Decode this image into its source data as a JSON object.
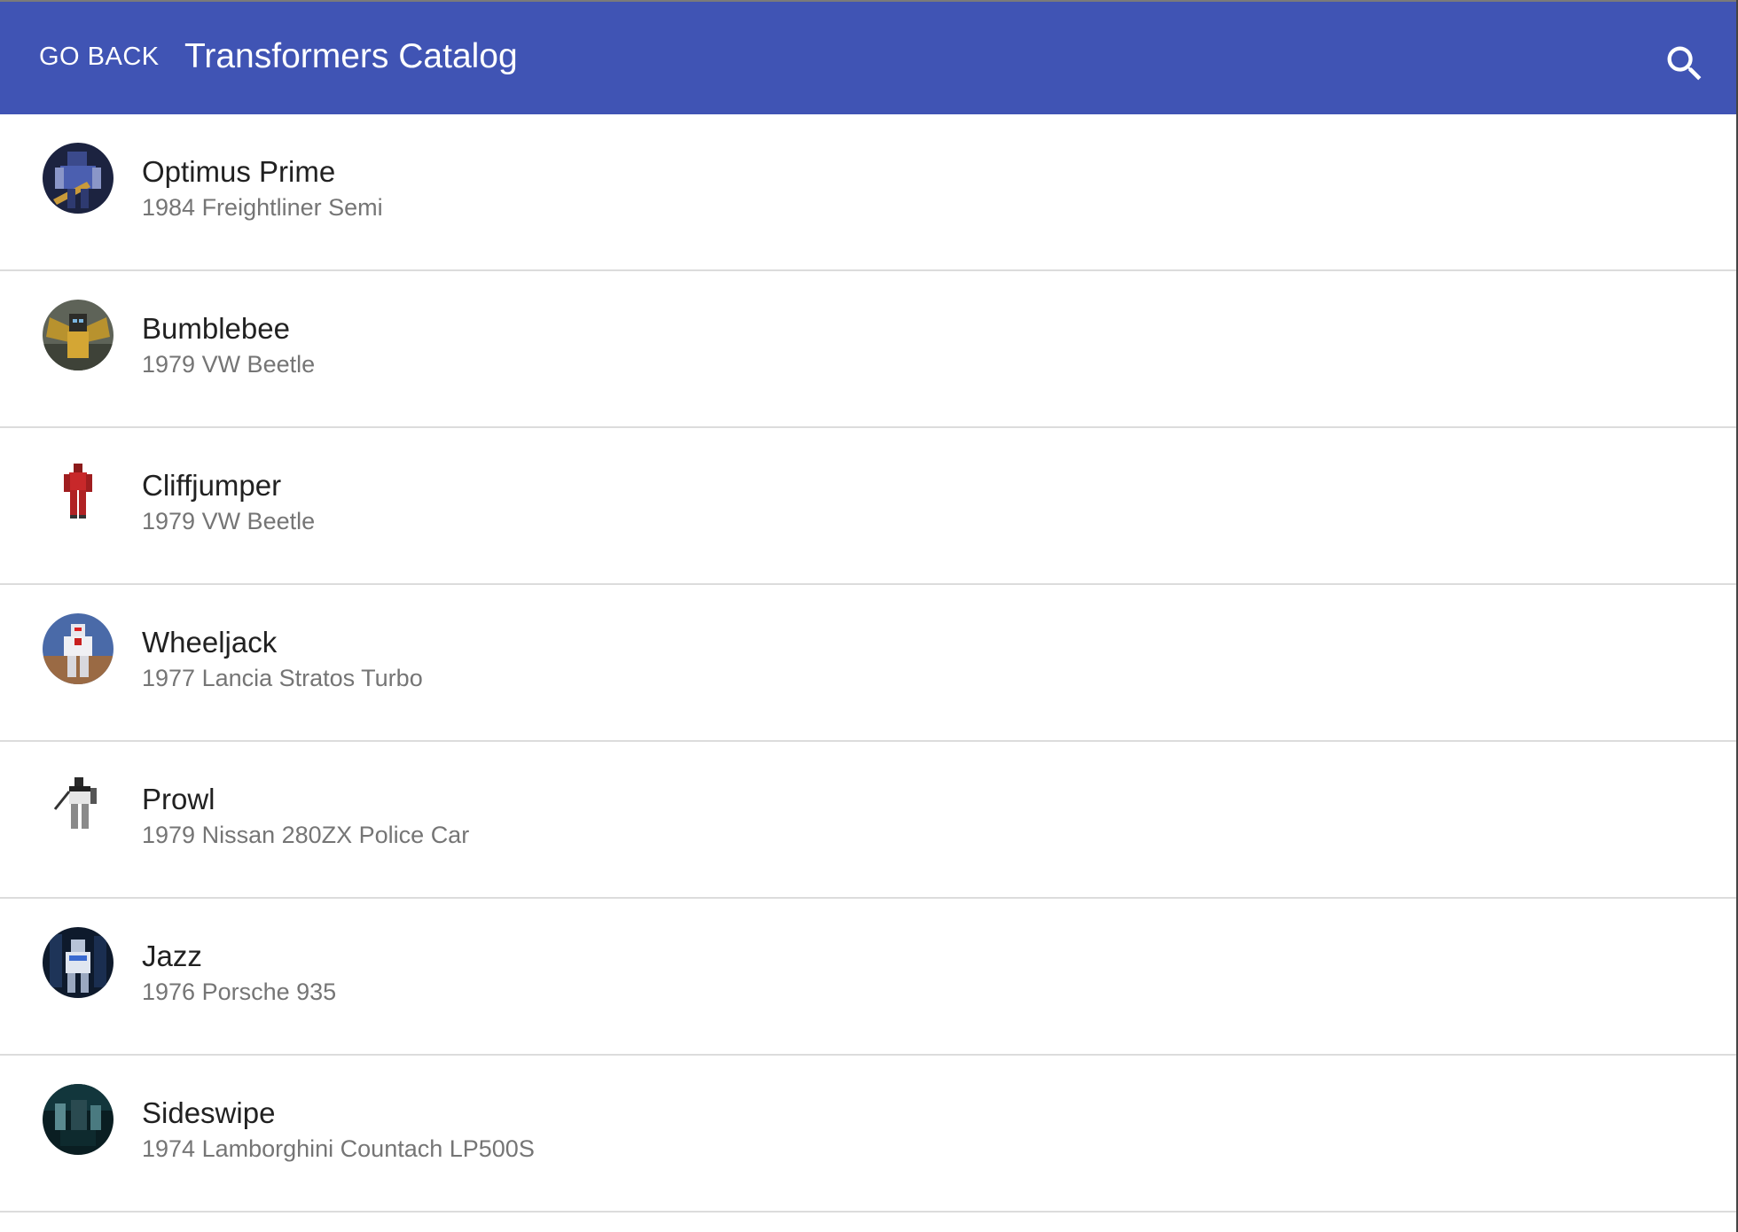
{
  "appbar": {
    "back_label": "GO BACK",
    "title": "Transformers Catalog",
    "search_icon": "search-icon",
    "color": "#4054b4"
  },
  "items": [
    {
      "name": "Optimus Prime",
      "vehicle": "1984 Freightliner Semi",
      "avatar": "optimus-prime-avatar"
    },
    {
      "name": "Bumblebee",
      "vehicle": "1979 VW Beetle",
      "avatar": "bumblebee-avatar"
    },
    {
      "name": "Cliffjumper",
      "vehicle": "1979 VW Beetle",
      "avatar": "cliffjumper-avatar"
    },
    {
      "name": "Wheeljack",
      "vehicle": "1977 Lancia Stratos Turbo",
      "avatar": "wheeljack-avatar"
    },
    {
      "name": "Prowl",
      "vehicle": "1979 Nissan 280ZX Police Car",
      "avatar": "prowl-avatar"
    },
    {
      "name": "Jazz",
      "vehicle": "1976 Porsche 935",
      "avatar": "jazz-avatar"
    },
    {
      "name": "Sideswipe",
      "vehicle": "1974 Lamborghini Countach LP500S",
      "avatar": "sideswipe-avatar"
    }
  ]
}
